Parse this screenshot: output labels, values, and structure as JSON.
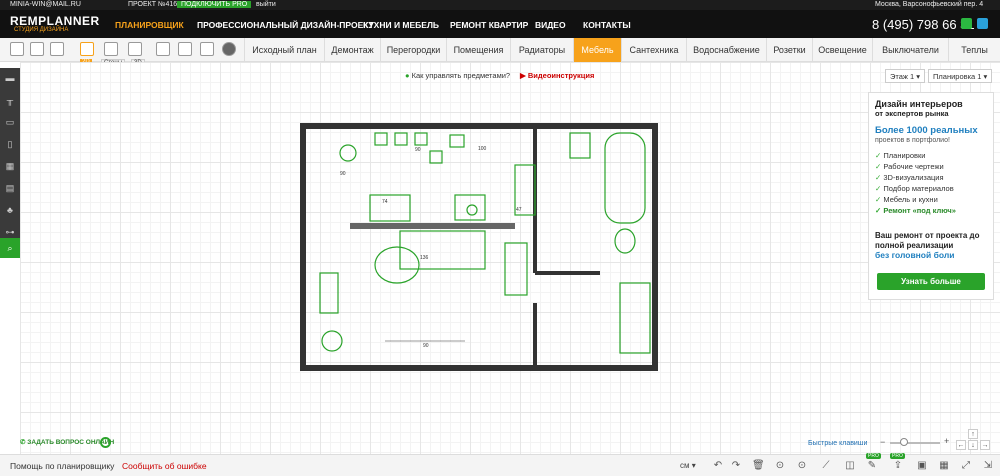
{
  "topbar": {
    "email": "MINIA-WIN@MAIL.RU",
    "project": "ПРОЕКТ №4166643",
    "connect_pro": "ПОДКЛЮЧИТЬ PRO",
    "logout": "выйти",
    "address": "Москва, Варсонофьевский пер. 4"
  },
  "header": {
    "logo": "REMPLANNER",
    "logo_sub": "СТУДИЯ ДИЗАЙНА",
    "nav": [
      "ПЛАНИРОВЩИК",
      "ПРОФЕССИОНАЛЬНЫЙ ДИЗАЙН-ПРОЕКТ",
      "КУХНИ И МЕБЕЛЬ",
      "РЕМОНТ КВАРТИР",
      "ВИДЕО",
      "КОНТАКТЫ"
    ],
    "phone": "8 (495) 798 66 31"
  },
  "toolbar": {
    "badge_2d": "2D",
    "badge_walls": "Стены",
    "badge_3d": "3D",
    "tabs": [
      "Исходный план",
      "Демонтаж",
      "Перегородки",
      "Помещения",
      "Радиаторы",
      "Мебель",
      "Сантехника",
      "Водоснабжение",
      "Розетки",
      "Освещение",
      "Выключатели",
      "Теплы"
    ]
  },
  "hints": {
    "help": "Как управлять предметами?",
    "video": "Видеоинструкция"
  },
  "floor": {
    "floor_select": "Этаж 1",
    "plan_select": "Планировка 1"
  },
  "ad": {
    "title1": "Дизайн интерьеров",
    "title2": "от экспертов рынка",
    "big": "Более 1000 реальных",
    "sub": "проектов в портфолио!",
    "items": [
      "Планировки",
      "Рабочие чертежи",
      "3D-визуализация",
      "Подбор материалов",
      "Мебель и кухни",
      "Ремонт «под ключ»"
    ],
    "repair": "Ваш ремонт от проекта до полной реализации",
    "no_headache": "без головной боли",
    "button": "Узнать больше"
  },
  "plan_dims": [
    "136",
    "74",
    "47",
    "90",
    "90",
    "90",
    "100"
  ],
  "bottom": {
    "ask": "ЗАДАТЬ ВОПРОС ОНЛАЙН",
    "hotkeys": "Быстрые клавиши",
    "help": "Помощь по планировщику",
    "report": "Сообщить об ошибке",
    "unit": "см",
    "pro": "PRO"
  },
  "colors": {
    "accent": "#f7a21b",
    "green": "#2aa32a",
    "red": "#cc0000",
    "blue": "#1f7fbf"
  }
}
